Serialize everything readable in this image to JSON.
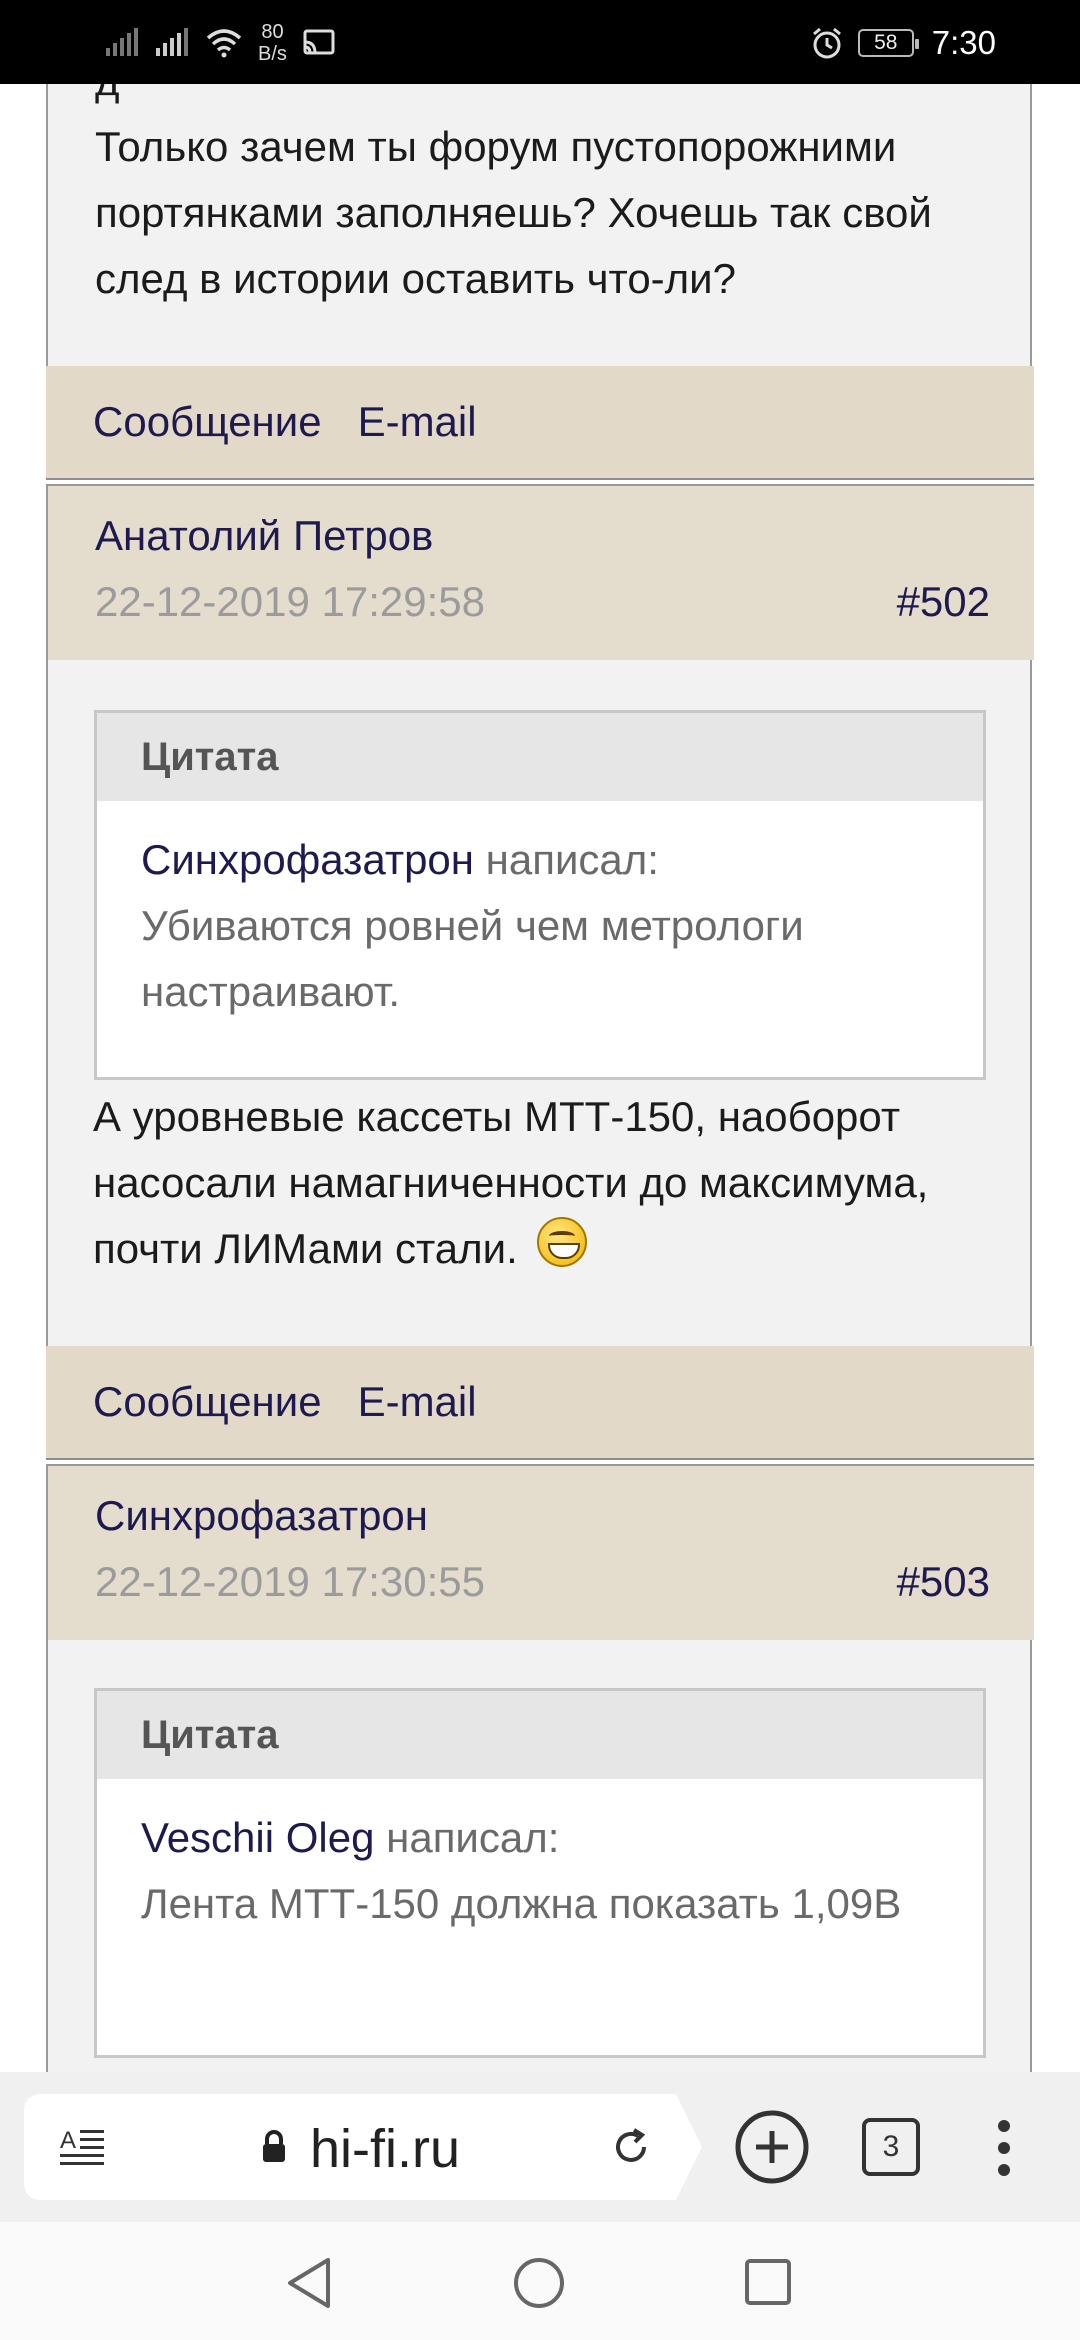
{
  "status_bar": {
    "net_speed_value": "80",
    "net_speed_unit": "B/s",
    "battery": "58",
    "time": "7:30"
  },
  "post_top": {
    "text_partial": "д",
    "text": "Только зачем ты форум пустопорожними портянками заполняешь? Хочешь так свой след в истории оставить что-ли?",
    "actions": {
      "message": "Сообщение",
      "email": "E-mail"
    }
  },
  "post_502": {
    "author": "Анатолий Петров",
    "date": "22-12-2019 17:29:58",
    "number": "#502",
    "quote": {
      "title": "Цитата",
      "author": "Синхрофазатрон",
      "wrote": "написал:",
      "text": "Убиваются ровней чем метрологи настраивают."
    },
    "text": "А уровневые кассеты МТТ-150, наоборот насосали намагниченности до максимума, почти ЛИМами стали.",
    "actions": {
      "message": "Сообщение",
      "email": "E-mail"
    }
  },
  "post_503": {
    "author": "Синхрофазатрон",
    "date": "22-12-2019 17:30:55",
    "number": "#503",
    "quote": {
      "title": "Цитата",
      "author": "Veschii Oleg",
      "wrote": "написал:",
      "text": "Лента МТТ-150 должна показать 1,09В"
    }
  },
  "toolbar": {
    "url": "hi-fi.ru",
    "tab_count": "3"
  },
  "icons": [
    "reader-mode-icon",
    "lock-icon",
    "reload-icon",
    "new-tab-icon",
    "tabs-icon",
    "menu-icon",
    "back-icon",
    "home-icon",
    "recents-icon",
    "signal-icon",
    "wifi-icon",
    "cast-icon",
    "alarm-icon",
    "smiley-icon"
  ]
}
